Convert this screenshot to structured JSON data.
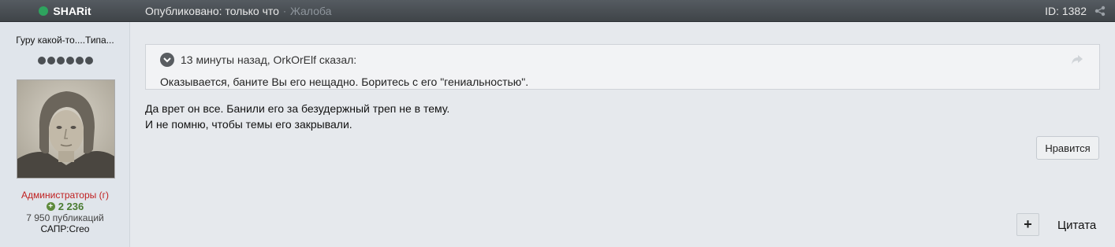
{
  "header": {
    "username": "SHARit",
    "published": "Опубликовано: только что",
    "separator": "·",
    "report": "Жалоба",
    "post_id": "ID: 1382"
  },
  "author": {
    "title": "Гуру какой-то....Типа...",
    "rank_dots": 6,
    "group": "Администраторы (г)",
    "reputation": "2 236",
    "posts": "7 950 публикаций",
    "cad": "САПР:Creo"
  },
  "quote": {
    "header": "13 минуты назад, OrkOrElf сказал:",
    "text": "Оказывается, баните Вы его нещадно. Боритесь с его \"гениальностью\"."
  },
  "post": {
    "line1": "Да врет он все. Банили его за безудержный треп не в тему.",
    "line2": "И не помню, чтобы темы его закрывали."
  },
  "actions": {
    "like": "Нравится",
    "multiquote": "+",
    "quote": "Цитата"
  },
  "colors": {
    "online": "#2ea35e",
    "group": "#c02020",
    "reputation": "#4a7b32"
  }
}
